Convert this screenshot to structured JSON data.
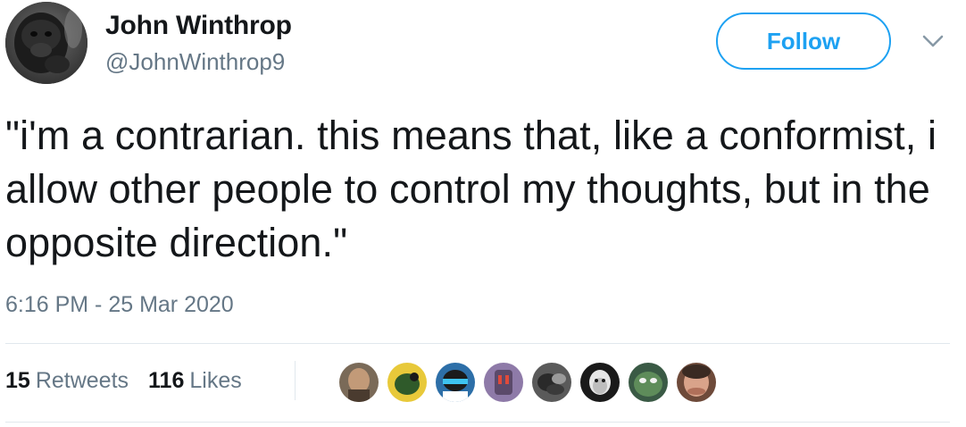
{
  "author": {
    "name": "John Winthrop",
    "handle": "@JohnWinthrop9"
  },
  "follow_button": {
    "label": "Follow"
  },
  "menu": {
    "icon": "chevron-down-icon"
  },
  "tweet": {
    "text": "\"i'm a contrarian. this means that, like a conformist, i allow other people to control my thoughts, but in the opposite direction.\"",
    "timestamp": "6:16 PM - 25 Mar 2020"
  },
  "stats": {
    "retweets_count": "15",
    "retweets_label": "Retweets",
    "likes_count": "116",
    "likes_label": "Likes"
  },
  "colors": {
    "accent": "#1da1f2",
    "secondary_text": "#657786",
    "primary_text": "#14171a",
    "divider": "#e1e8ed"
  }
}
